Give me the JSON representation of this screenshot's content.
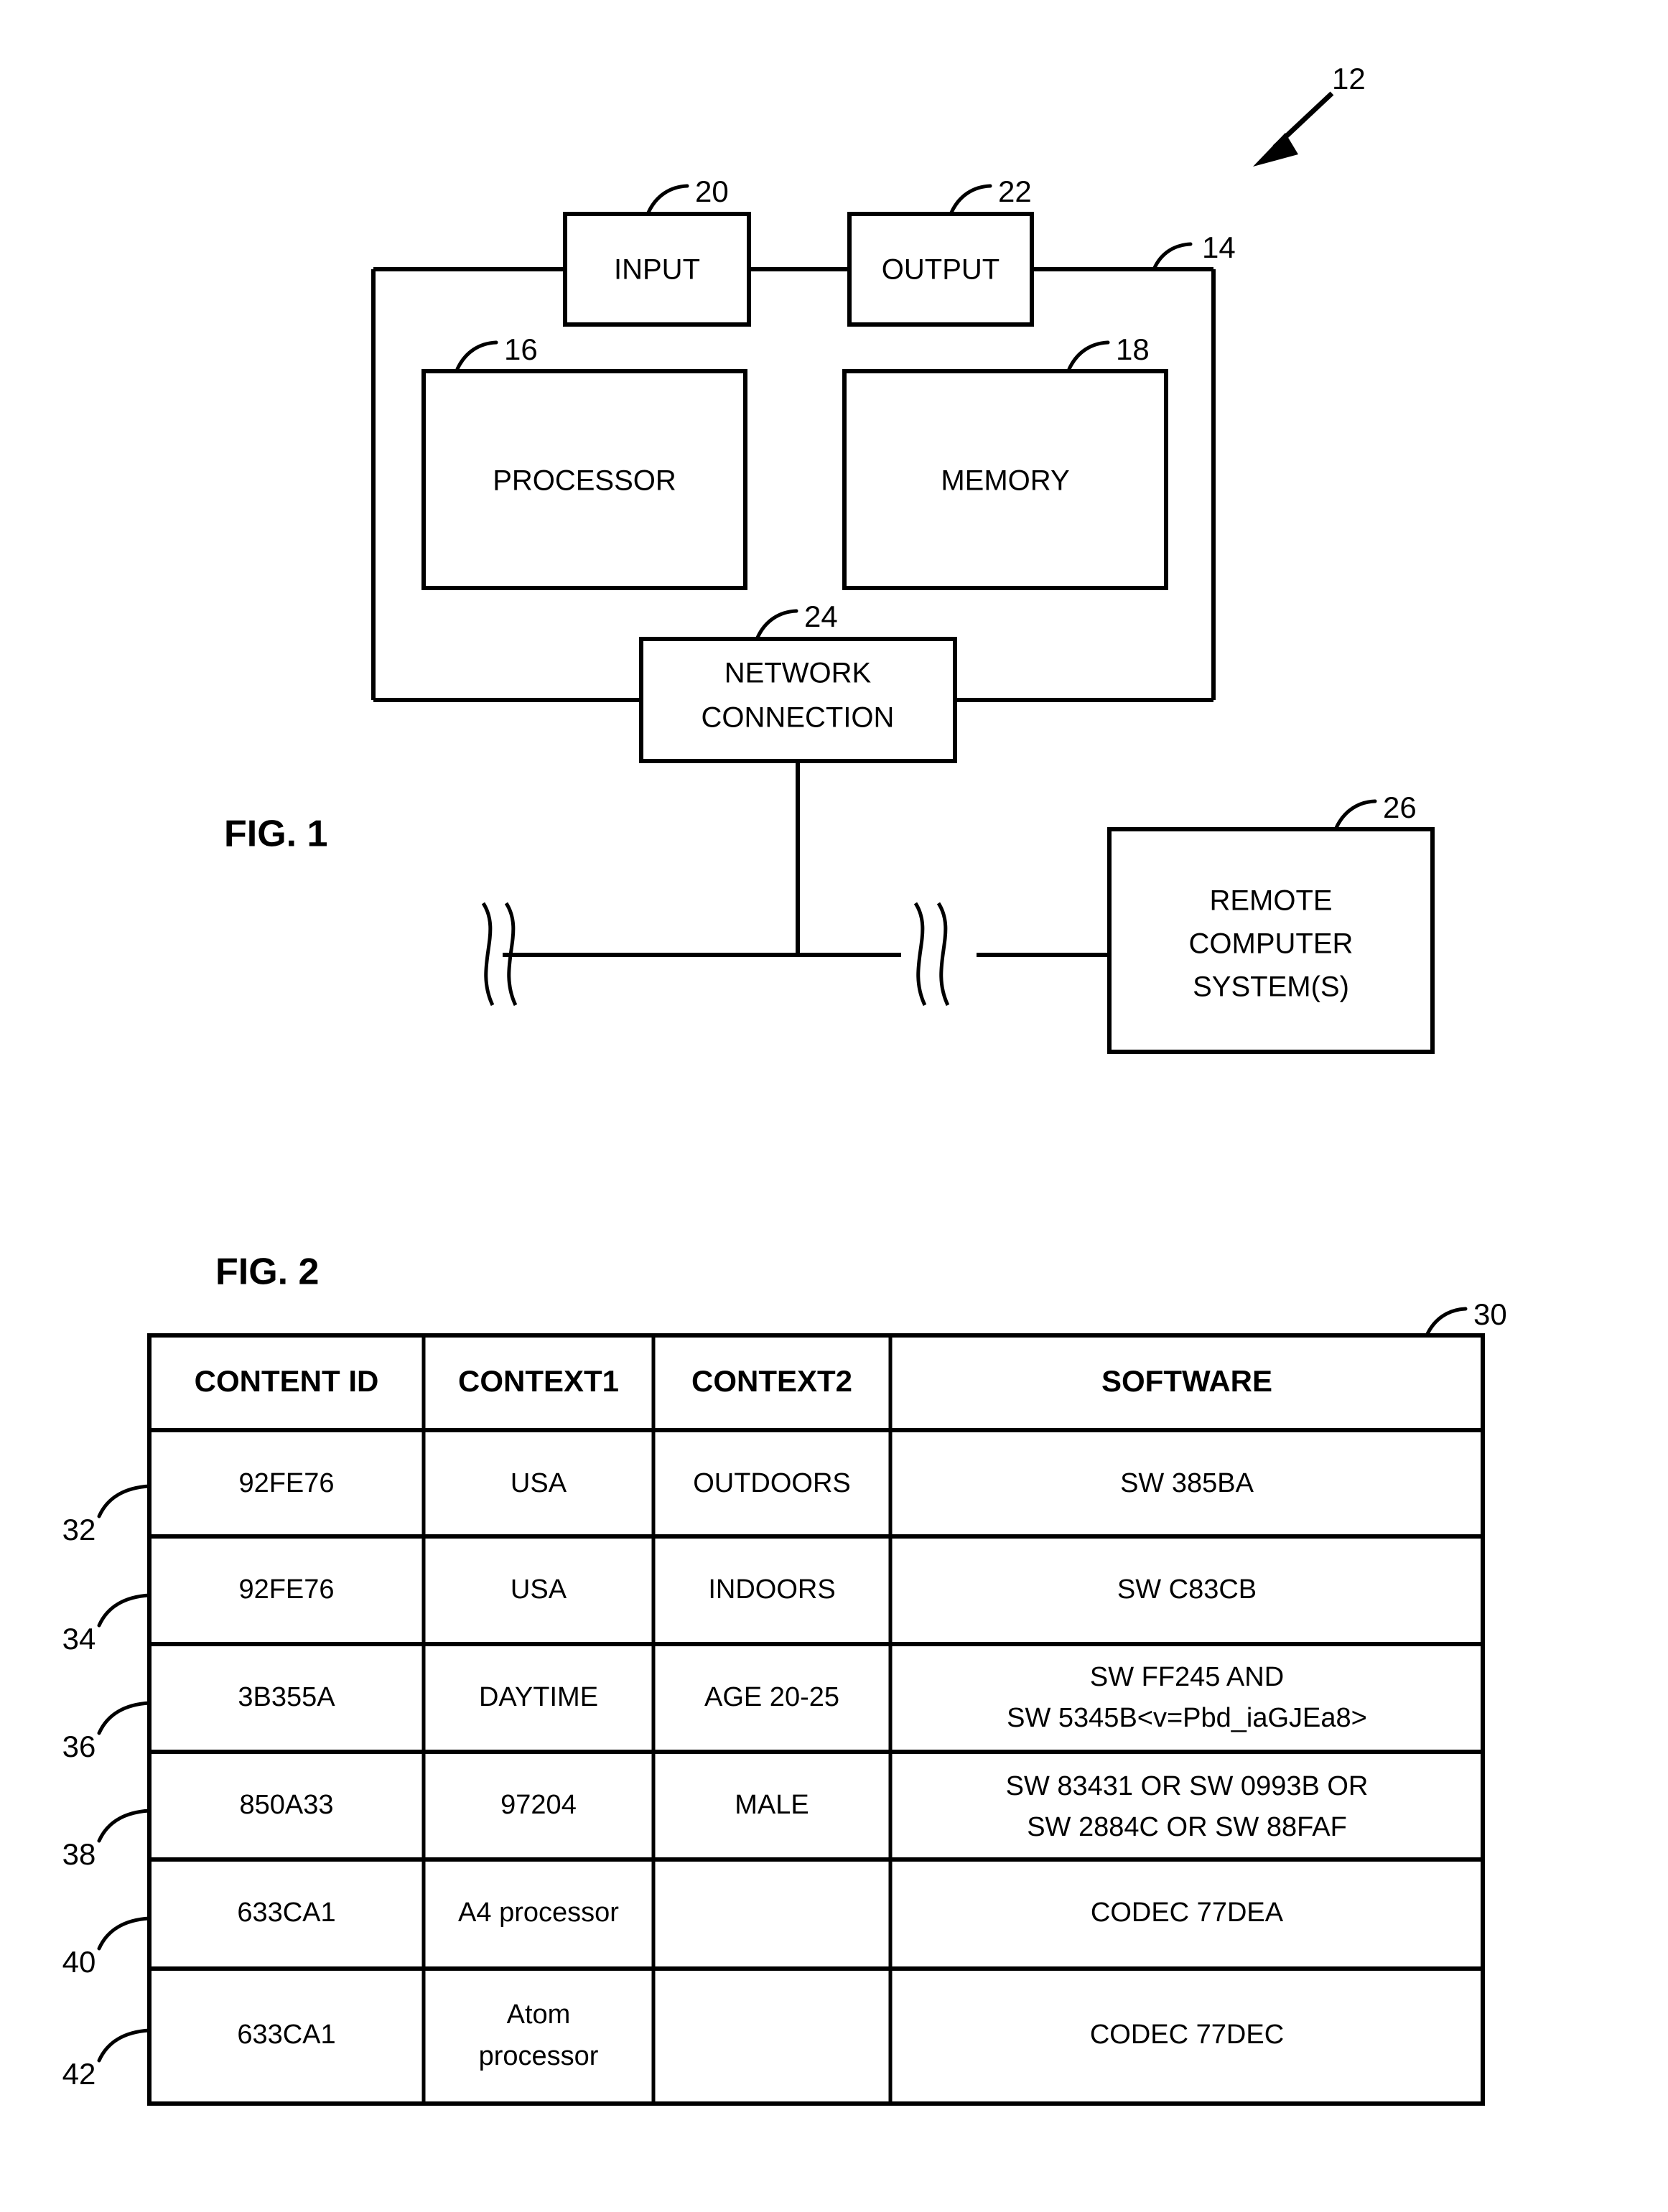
{
  "figure1": {
    "label": "FIG. 1",
    "system_ref": "12",
    "bus_ref": "14",
    "blocks": [
      {
        "id": "input",
        "label": "INPUT",
        "ref": "20"
      },
      {
        "id": "output",
        "label": "OUTPUT",
        "ref": "22"
      },
      {
        "id": "processor",
        "label": "PROCESSOR",
        "ref": "16"
      },
      {
        "id": "memory",
        "label": "MEMORY",
        "ref": "18"
      },
      {
        "id": "network",
        "label_line1": "NETWORK",
        "label_line2": "CONNECTION",
        "ref": "24"
      },
      {
        "id": "remote",
        "label_line1": "REMOTE",
        "label_line2": "COMPUTER",
        "label_line3": "SYSTEM(S)",
        "ref": "26"
      }
    ]
  },
  "figure2": {
    "label": "FIG. 2",
    "table_ref": "30",
    "columns": [
      "CONTENT ID",
      "CONTEXT1",
      "CONTEXT2",
      "SOFTWARE"
    ],
    "rows": [
      {
        "ref": "32",
        "content_id": "92FE76",
        "context1": "USA",
        "context2": "OUTDOORS",
        "software": [
          "SW 385BA"
        ]
      },
      {
        "ref": "34",
        "content_id": "92FE76",
        "context1": "USA",
        "context2": "INDOORS",
        "software": [
          "SW C83CB"
        ]
      },
      {
        "ref": "36",
        "content_id": "3B355A",
        "context1": "DAYTIME",
        "context2": "AGE 20-25",
        "software": [
          "SW FF245 AND",
          "SW 5345B<v=Pbd_iaGJEa8>"
        ]
      },
      {
        "ref": "38",
        "content_id": "850A33",
        "context1": "97204",
        "context2": "MALE",
        "software": [
          "SW 83431 OR SW 0993B OR",
          "SW 2884C OR SW 88FAF"
        ]
      },
      {
        "ref": "40",
        "content_id": "633CA1",
        "context1": "A4 processor",
        "context2": "",
        "software": [
          "CODEC 77DEA"
        ]
      },
      {
        "ref": "42",
        "content_id": "633CA1",
        "context1_line1": "Atom",
        "context1_line2": "processor",
        "context1": "",
        "context2": "",
        "software": [
          "CODEC 77DEC"
        ]
      }
    ]
  },
  "colors": {
    "ink": "#000000",
    "paper": "#ffffff"
  }
}
